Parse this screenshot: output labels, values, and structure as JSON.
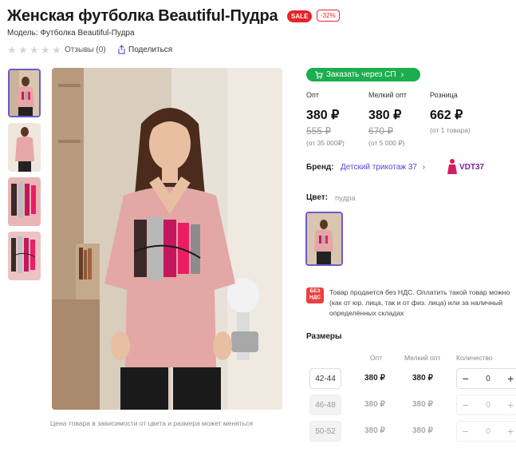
{
  "product": {
    "title": "Женская футболка Beautiful-Пудра",
    "sale_badge": "SALE",
    "discount_badge": "-32%",
    "model": "Модель: Футболка Beautiful-Пудра",
    "rating_stars": 0,
    "reviews": "Отзывы (0)",
    "share": "Поделиться"
  },
  "gallery": {
    "caption": "Цена товара в зависимости от цвета и размера может меняться",
    "thumbnails_count": 4,
    "selected_index": 0
  },
  "sp_button": {
    "label": "Заказать через СП"
  },
  "prices": [
    {
      "header": "Опт",
      "price": "380 ₽",
      "old": "555 ₽",
      "note": "(от 35 000₽)"
    },
    {
      "header": "Мелкий опт",
      "price": "380 ₽",
      "old": "670 ₽",
      "note": "(от 5 000 ₽)"
    },
    {
      "header": "Розница",
      "price": "662 ₽",
      "old": "",
      "note": "(от 1 товара)"
    }
  ],
  "brand": {
    "label": "Бренд:",
    "value": "Детский трикотаж 37",
    "logo_text": "VDT37"
  },
  "color": {
    "label": "Цвет:",
    "value": "пудра"
  },
  "nds": {
    "icon_line1": "БЕЗ",
    "icon_line2": "НДС",
    "line1": "Товар продается без НДС. Оплатить такой товар можно",
    "line2": "(как от юр. лица, так и от физ. лица) или за наличный",
    "line3": "определённых складах"
  },
  "sizes": {
    "title": "Размеры",
    "headers": {
      "opt": "Опт",
      "small_opt": "Мелкий опт",
      "qty": "Количество"
    },
    "rows": [
      {
        "size": "42-44",
        "opt": "380 ₽",
        "small_opt": "380 ₽",
        "qty": "0",
        "available": true
      },
      {
        "size": "46-48",
        "opt": "380 ₽",
        "small_opt": "380 ₽",
        "qty": "0",
        "available": false
      },
      {
        "size": "50-52",
        "opt": "380 ₽",
        "small_opt": "380 ₽",
        "qty": "0",
        "available": false
      }
    ]
  },
  "colors": {
    "accent_purple": "#6a5acd",
    "sale_red": "#e8232a",
    "sp_green": "#1cae4e",
    "link_purple": "#5a43d6"
  }
}
